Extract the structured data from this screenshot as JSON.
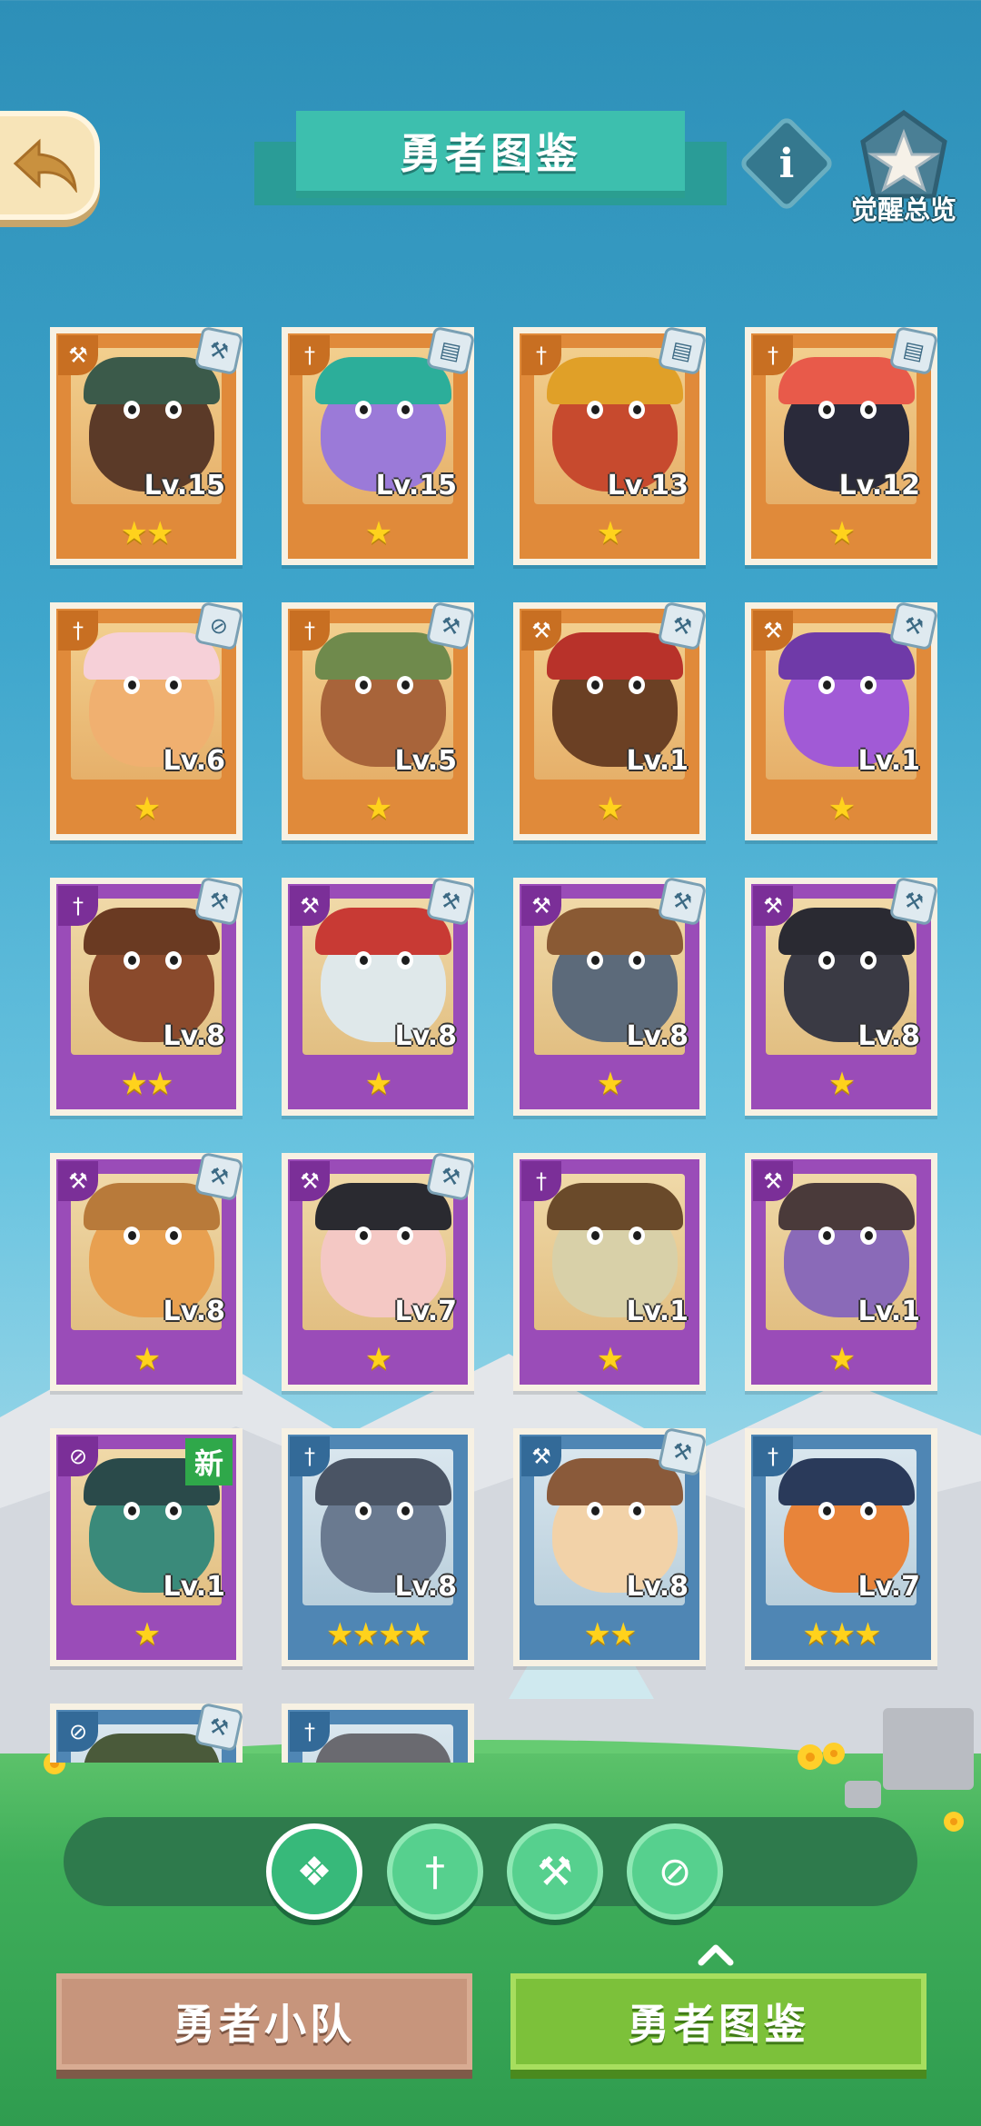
{
  "header": {
    "back_icon": "back-arrow-icon",
    "title": "勇者图鉴",
    "info_icon": "info-icon",
    "awaken_label": "觉醒总览"
  },
  "cards": [
    {
      "level": "Lv.15",
      "stars": 2,
      "frame": "orange",
      "face": "#5b3a28",
      "hat": "#3b5a4a",
      "class_icon": "hammer-icon",
      "weapon_icon": "hammer-icon"
    },
    {
      "level": "Lv.15",
      "stars": 1,
      "frame": "orange",
      "face": "#9b7ad8",
      "hat": "#2cae9a",
      "class_icon": "sword-icon",
      "weapon_icon": "scroll-icon"
    },
    {
      "level": "Lv.13",
      "stars": 1,
      "frame": "orange",
      "face": "#c74a2e",
      "hat": "#e0a028",
      "class_icon": "sword-icon",
      "weapon_icon": "scroll-icon"
    },
    {
      "level": "Lv.12",
      "stars": 1,
      "frame": "orange",
      "face": "#2a2a3a",
      "hat": "#e85a4a",
      "class_icon": "sword-icon",
      "weapon_icon": "scroll-icon"
    },
    {
      "level": "Lv.6",
      "stars": 1,
      "frame": "orange",
      "face": "#f0b070",
      "hat": "#f6d0d8",
      "class_icon": "sword-icon",
      "weapon_icon": "compass-icon"
    },
    {
      "level": "Lv.5",
      "stars": 1,
      "frame": "orange",
      "face": "#a8643a",
      "hat": "#6f8a4c",
      "class_icon": "sword-icon",
      "weapon_icon": "hammer-icon"
    },
    {
      "level": "Lv.1",
      "stars": 1,
      "frame": "orange",
      "face": "#6b4024",
      "hat": "#b8322a",
      "class_icon": "hammer-icon",
      "weapon_icon": "hammer-icon"
    },
    {
      "level": "Lv.1",
      "stars": 1,
      "frame": "orange",
      "face": "#a15ad6",
      "hat": "#6f3aa8",
      "class_icon": "hammer-icon",
      "weapon_icon": "hammer-icon"
    },
    {
      "level": "Lv.8",
      "stars": 2,
      "frame": "purple",
      "face": "#8a4a2c",
      "hat": "#6a3a22",
      "class_icon": "sword-icon",
      "weapon_icon": "hammer-icon"
    },
    {
      "level": "Lv.8",
      "stars": 1,
      "frame": "purple",
      "face": "#dfe8ea",
      "hat": "#c83a34",
      "class_icon": "hammer-icon",
      "weapon_icon": "hammer-icon"
    },
    {
      "level": "Lv.8",
      "stars": 1,
      "frame": "purple",
      "face": "#5c6a7a",
      "hat": "#8a5a34",
      "class_icon": "hammer-icon",
      "weapon_icon": "hammer-icon"
    },
    {
      "level": "Lv.8",
      "stars": 1,
      "frame": "purple",
      "face": "#3a3a44",
      "hat": "#2a2a32",
      "class_icon": "hammer-icon",
      "weapon_icon": "hammer-icon"
    },
    {
      "level": "Lv.8",
      "stars": 1,
      "frame": "purple",
      "face": "#e8a050",
      "hat": "#b87a3a",
      "class_icon": "hammer-icon",
      "weapon_icon": "hammer-icon"
    },
    {
      "level": "Lv.7",
      "stars": 1,
      "frame": "purple",
      "face": "#f4c8c4",
      "hat": "#2a2a30",
      "class_icon": "hammer-icon",
      "weapon_icon": "hammer-icon"
    },
    {
      "level": "Lv.1",
      "stars": 1,
      "frame": "purple",
      "face": "#d8d0a8",
      "hat": "#6a4a2a",
      "class_icon": "sword-icon",
      "weapon_icon": ""
    },
    {
      "level": "Lv.1",
      "stars": 1,
      "frame": "purple",
      "face": "#8a6ab8",
      "hat": "#4a3a3a",
      "class_icon": "hammer-icon",
      "weapon_icon": ""
    },
    {
      "level": "Lv.1",
      "stars": 1,
      "frame": "purple",
      "face": "#3a8a7a",
      "hat": "#2a4a4a",
      "class_icon": "compass-icon",
      "weapon_icon": "",
      "new_label": "新"
    },
    {
      "level": "Lv.8",
      "stars": 4,
      "frame": "blue",
      "face": "#6a7a90",
      "hat": "#4a5464",
      "class_icon": "sword-icon",
      "weapon_icon": ""
    },
    {
      "level": "Lv.8",
      "stars": 2,
      "frame": "blue",
      "face": "#f2d2a8",
      "hat": "#8a5a3a",
      "class_icon": "hammer-icon",
      "weapon_icon": "hammer-icon"
    },
    {
      "level": "Lv.7",
      "stars": 3,
      "frame": "blue",
      "face": "#e8843a",
      "hat": "#2a3a5a",
      "class_icon": "sword-icon",
      "weapon_icon": ""
    },
    {
      "level": "",
      "stars": 0,
      "frame": "blue",
      "face": "#4a4a3a",
      "hat": "#4a5a3a",
      "class_icon": "compass-icon",
      "weapon_icon": "hammer-icon"
    },
    {
      "level": "",
      "stars": 0,
      "frame": "blue",
      "face": "#8a8a90",
      "hat": "#6a6a70",
      "class_icon": "sword-icon",
      "weapon_icon": ""
    }
  ],
  "filters": [
    {
      "icon": "all-classes-icon",
      "active": true
    },
    {
      "icon": "sword-icon",
      "active": false
    },
    {
      "icon": "hammer-icon",
      "active": false
    },
    {
      "icon": "compass-icon",
      "active": false
    }
  ],
  "tabs": {
    "team_label": "勇者小队",
    "dex_label": "勇者图鉴"
  }
}
